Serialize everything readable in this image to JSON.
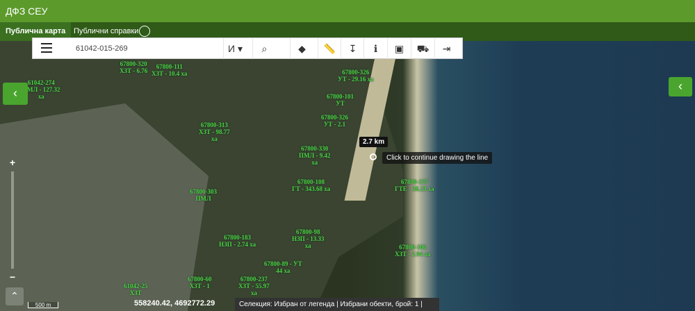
{
  "app": {
    "title": "ДФЗ СЕУ"
  },
  "nav": {
    "tabs": [
      {
        "label": "Публична карта"
      },
      {
        "label": "Публични справки"
      }
    ]
  },
  "toolbar": {
    "search_value": "61042-015-269",
    "buttons": [
      {
        "name": "text-style-button",
        "icon": "И",
        "glyph": "И ▾"
      },
      {
        "name": "search-button",
        "icon": "search-icon",
        "glyph": "⌕"
      },
      {
        "name": "draw-shape-button",
        "icon": "shape-icon",
        "glyph": "◆"
      },
      {
        "name": "measure-button",
        "icon": "ruler-icon",
        "glyph": "📏"
      },
      {
        "name": "dimension-button",
        "icon": "dimension-icon",
        "glyph": "↧"
      },
      {
        "name": "info-button",
        "icon": "info-icon",
        "glyph": "ℹ"
      },
      {
        "name": "layers-button",
        "icon": "layers-icon",
        "glyph": "▣"
      },
      {
        "name": "truck-button",
        "icon": "truck-icon",
        "glyph": "⛟"
      },
      {
        "name": "export-button",
        "icon": "export-icon",
        "glyph": "⇥"
      }
    ]
  },
  "map": {
    "parcels": [
      "61042-274\nПМЛ - 127.32\nха",
      "67800-320\nХЗТ - 6.76",
      "67800-111\nХЗТ - 10.4 ха",
      "67800-326\nУТ - 29.16 ха",
      "67800-101\nУТ",
      "67800-326\nУТ - 2.1",
      "67800-313\nХЗТ - 98.77\nха",
      "67800-330\nПМЛ - 9.42\nха",
      "67800-108\nГТ - 343.68 ха",
      "67800-157\nГТЕ - 38.23 ха",
      "67800-303\nПМЛ",
      "67800-98\nНЗП - 13.33\nха",
      "67800-183\nНЗП - 2.74 ха",
      "67800-89 - УТ\n44 ха",
      "67800-237\nХЗТ - 55.97\nха",
      "67800-106\nХЗТ - 2.94 ха",
      "67800-60\nХЗТ - 1",
      "61042-25\nХЗТ"
    ],
    "tooltip_distance": "2.7 km",
    "tooltip_hint": "Click to continue drawing the line"
  },
  "footer": {
    "scale": "500 m",
    "coordinates": "558240.42, 4692772.29",
    "status": "Селекция: Избран от легенда  |  Избрани обекти, брой: 1  |"
  }
}
